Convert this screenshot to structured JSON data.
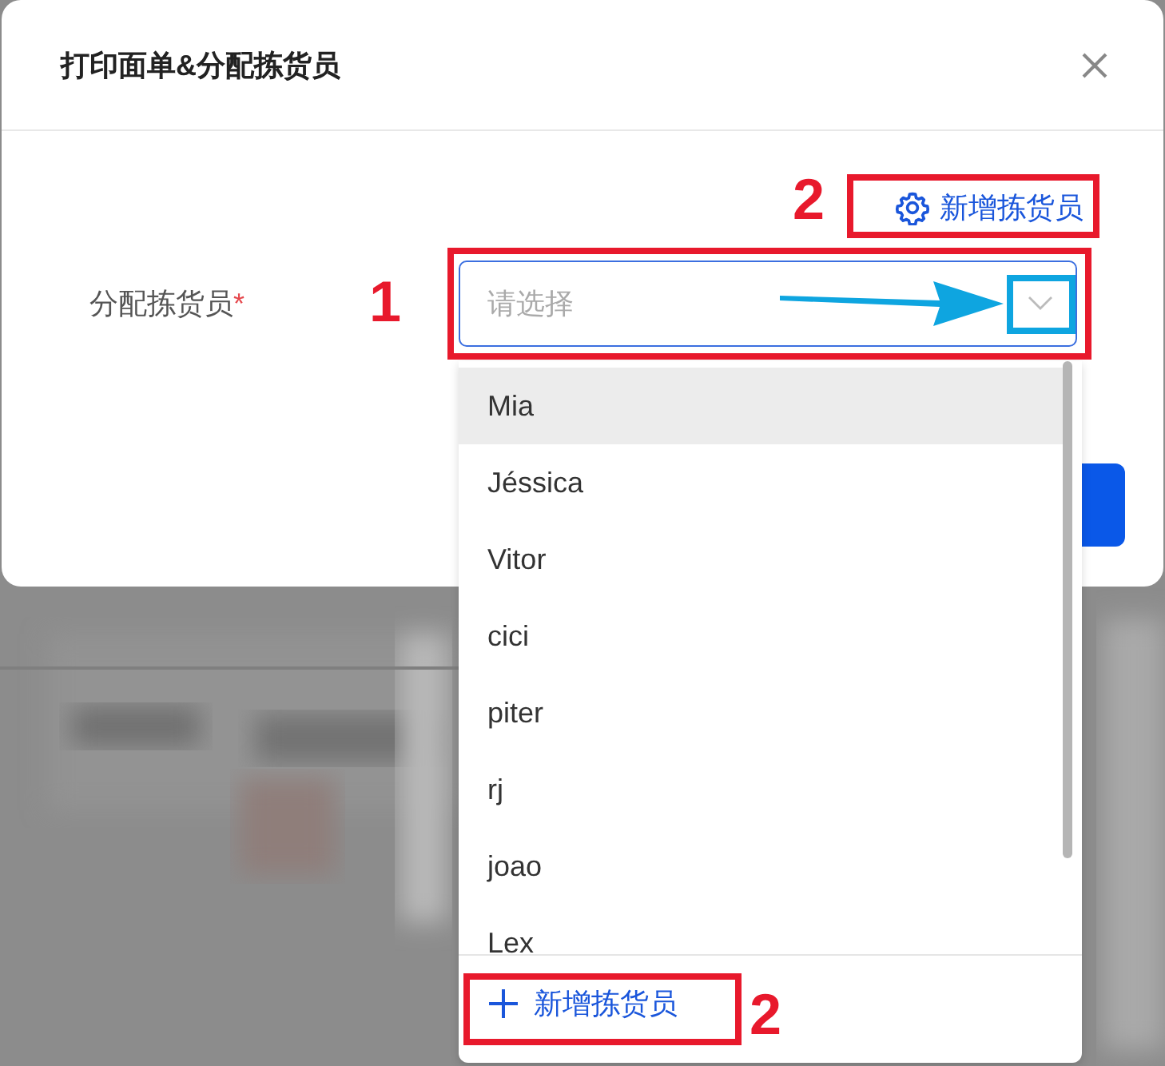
{
  "dialog": {
    "title": "打印面单&分配拣货员",
    "add_picker_link": "新增拣货员",
    "field": {
      "label": "分配拣货员",
      "required_mark": "*",
      "placeholder": "请选择"
    }
  },
  "dropdown": {
    "options": [
      {
        "label": "Mia",
        "selected": true
      },
      {
        "label": "Jéssica",
        "selected": false
      },
      {
        "label": "Vitor",
        "selected": false
      },
      {
        "label": "cici",
        "selected": false
      },
      {
        "label": "piter",
        "selected": false
      },
      {
        "label": "rj",
        "selected": false
      },
      {
        "label": "joao",
        "selected": false
      },
      {
        "label": "Lex",
        "selected": false
      }
    ],
    "footer_link": "新增拣货员"
  },
  "annotations": {
    "link_number": "2",
    "select_number": "1",
    "footer_number": "2"
  }
}
